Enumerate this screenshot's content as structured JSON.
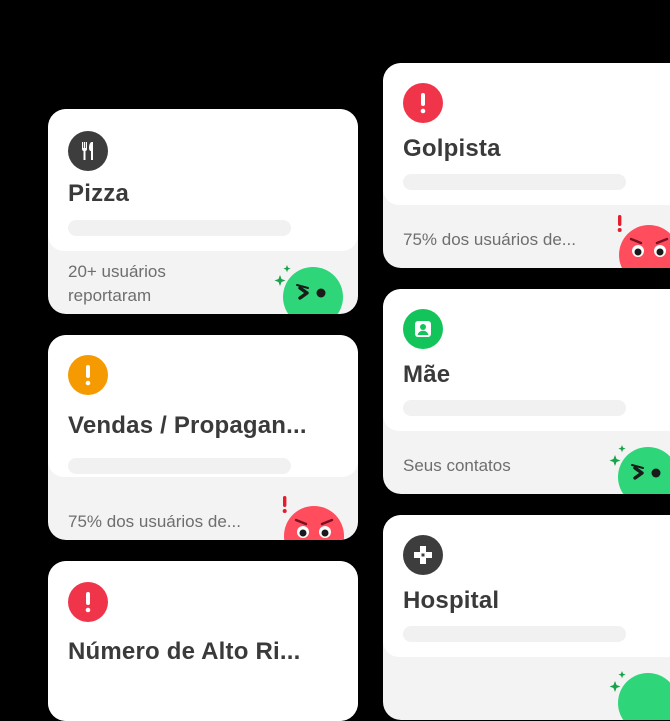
{
  "cards": [
    {
      "title": "Pizza",
      "subtitle_line1": "20+ usuários",
      "subtitle_line2": "reportaram",
      "icon": "fork-knife-icon",
      "icon_color": "#3d3d3d",
      "status": "safe"
    },
    {
      "title": "Vendas / Propagan...",
      "subtitle": "75% dos usuários de...",
      "icon": "exclamation-icon",
      "icon_color": "#f59a00",
      "status": "risk"
    },
    {
      "title": "Número de Alto Ri...",
      "icon": "exclamation-icon",
      "icon_color": "#f0344a",
      "status": "risk"
    },
    {
      "title": "Golpista",
      "subtitle": "75% dos usuários de...",
      "icon": "exclamation-icon",
      "icon_color": "#f0344a",
      "status": "risk"
    },
    {
      "title": "Mãe",
      "subtitle": "Seus contatos",
      "icon": "person-icon",
      "icon_color": "#12c45a",
      "status": "safe"
    },
    {
      "title": "Hospital",
      "icon": "medical-cross-icon",
      "icon_color": "#3d3d3d",
      "status": "safe"
    }
  ],
  "colors": {
    "safe_face": "#2ed679",
    "risk_face": "#ff4d5e",
    "background": "#000000",
    "card_bottom": "#f3f3f4"
  }
}
